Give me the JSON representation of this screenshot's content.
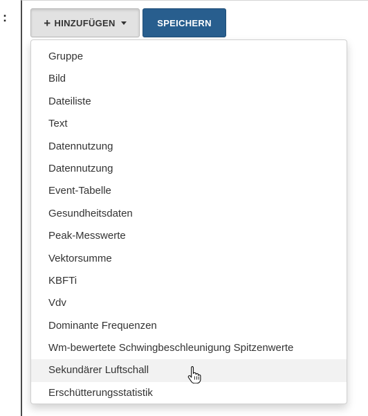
{
  "edge_mark": ":",
  "toolbar": {
    "add_label": "HINZUFÜGEN",
    "add_icon": "plus-icon",
    "caret_icon": "chevron-down-icon",
    "save_label": "SPEICHERN",
    "save_color": "#285e8e"
  },
  "dropdown": {
    "items": [
      {
        "label": "Gruppe"
      },
      {
        "label": "Bild"
      },
      {
        "label": "Dateiliste"
      },
      {
        "label": "Text"
      },
      {
        "label": "Datennutzung"
      },
      {
        "label": "Datennutzung"
      },
      {
        "label": "Event-Tabelle"
      },
      {
        "label": "Gesundheitsdaten"
      },
      {
        "label": "Peak-Messwerte"
      },
      {
        "label": "Vektorsumme"
      },
      {
        "label": "KBFTi"
      },
      {
        "label": "Vdv"
      },
      {
        "label": "Dominante Frequenzen"
      },
      {
        "label": "Wm-bewertete Schwingbeschleunigung Spitzenwerte"
      },
      {
        "label": "Sekundärer Luftschall"
      },
      {
        "label": "Erschütterungsstatistik"
      }
    ],
    "hover_color": "#f2f2f2"
  }
}
